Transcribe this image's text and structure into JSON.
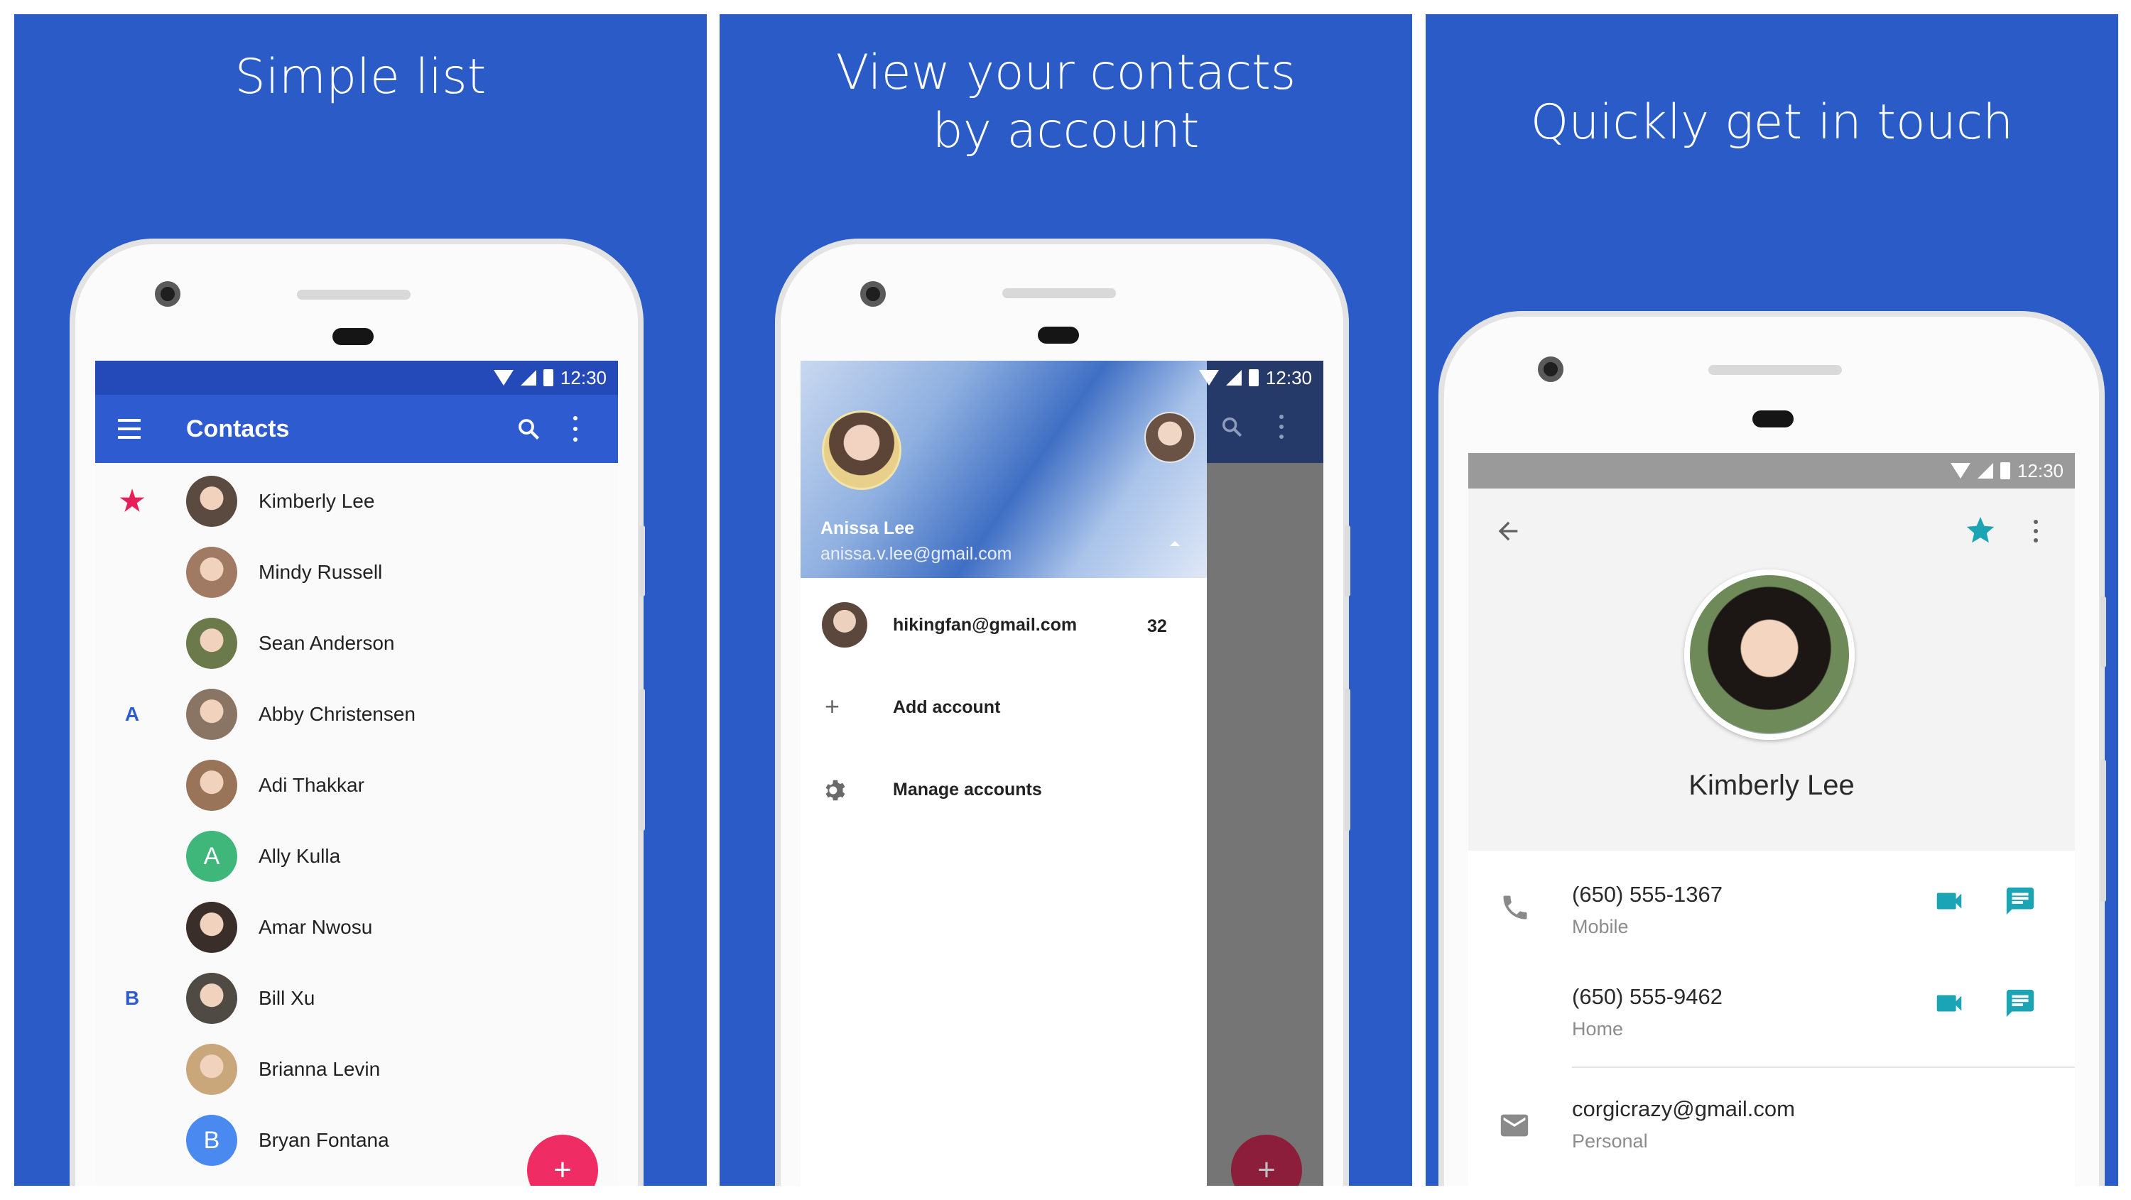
{
  "panel1": {
    "caption": "Simple list",
    "status_time": "12:30",
    "app_title": "Contacts",
    "contacts": [
      {
        "name": "Kimberly Lee",
        "section": "★",
        "avatar_initial": "",
        "avatar_color": "#5a4a3f"
      },
      {
        "name": "Mindy Russell",
        "section": "",
        "avatar_initial": "",
        "avatar_color": "#a07a63"
      },
      {
        "name": "Sean Anderson",
        "section": "",
        "avatar_initial": "",
        "avatar_color": "#6c7a4b"
      },
      {
        "name": "Abby Christensen",
        "section": "A",
        "avatar_initial": "",
        "avatar_color": "#8a7565"
      },
      {
        "name": "Adi Thakkar",
        "section": "",
        "avatar_initial": "",
        "avatar_color": "#9a7458"
      },
      {
        "name": "Ally Kulla",
        "section": "",
        "avatar_initial": "A",
        "avatar_color": "#3fb77b"
      },
      {
        "name": "Amar Nwosu",
        "section": "",
        "avatar_initial": "",
        "avatar_color": "#3a2e2a"
      },
      {
        "name": "Bill Xu",
        "section": "B",
        "avatar_initial": "",
        "avatar_color": "#4f4a44"
      },
      {
        "name": "Brianna Levin",
        "section": "",
        "avatar_initial": "",
        "avatar_color": "#c9a77a"
      },
      {
        "name": "Bryan Fontana",
        "section": "",
        "avatar_initial": "B",
        "avatar_color": "#4a8af0"
      }
    ],
    "fab_label": "+"
  },
  "panel2": {
    "caption_line1": "View your contacts",
    "caption_line2": "by account",
    "status_time": "12:30",
    "account_name": "Anissa Lee",
    "account_email": "anissa.v.lee@gmail.com",
    "accounts": [
      {
        "email": "hikingfan@gmail.com",
        "count": "32"
      }
    ],
    "add_account": "Add account",
    "manage_accounts": "Manage accounts",
    "fab_label": "+"
  },
  "panel3": {
    "caption": "Quickly get in touch",
    "status_time": "12:30",
    "contact_name": "Kimberly Lee",
    "phones": [
      {
        "number": "(650) 555-1367",
        "type": "Mobile"
      },
      {
        "number": "(650) 555-9462",
        "type": "Home"
      }
    ],
    "email": {
      "address": "corgicrazy@gmail.com",
      "type": "Personal"
    }
  },
  "colors": {
    "background": "#2a5bc7",
    "app_bar": "#2f5bd0",
    "fab": "#ef2c63",
    "accent_teal": "#1ba4b4",
    "star_red": "#e8205a"
  }
}
